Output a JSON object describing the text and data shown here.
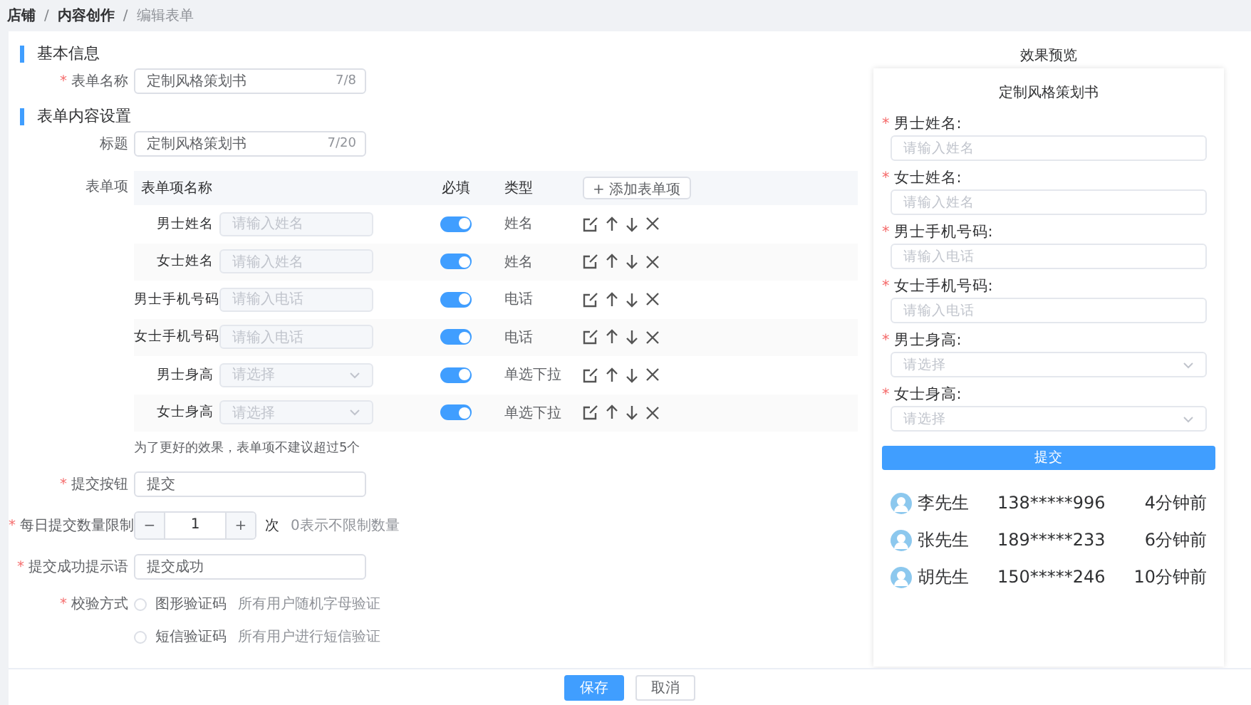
{
  "breadcrumb": [
    {
      "label": "店铺",
      "current": false
    },
    {
      "sep": "/",
      "label": "内容创作",
      "current": false
    },
    {
      "sep": "/",
      "label": "编辑表单",
      "current": true
    }
  ],
  "basic": {
    "heading": "基本信息",
    "name_field": {
      "star": "*",
      "label": "表单名称",
      "value": "定制风格策划书",
      "count": "7/8"
    }
  },
  "content": {
    "heading": "表单内容设置",
    "title_field": {
      "label": "标题",
      "value": "定制风格策划书",
      "count": "7/20"
    },
    "items_label": "表单项",
    "table": {
      "columns": [
        "表单项名称",
        "必填",
        "类型"
      ],
      "add_button": {
        "icon": "+",
        "label": "添加表单项"
      },
      "rows": [
        {
          "label": "男士姓名",
          "kind": "input",
          "placeholder": "请输入姓名",
          "required": true,
          "type": "姓名"
        },
        {
          "label": "女士姓名",
          "kind": "input",
          "placeholder": "请输入姓名",
          "required": true,
          "type": "姓名"
        },
        {
          "label": "男士手机号码",
          "kind": "input",
          "placeholder": "请输入电话",
          "required": true,
          "type": "电话"
        },
        {
          "label": "女士手机号码",
          "kind": "input",
          "placeholder": "请输入电话",
          "required": true,
          "type": "电话"
        },
        {
          "label": "男士身高",
          "kind": "select",
          "placeholder": "请选择",
          "required": true,
          "type": "单选下拉"
        },
        {
          "label": "女士身高",
          "kind": "select",
          "placeholder": "请选择",
          "required": true,
          "type": "单选下拉"
        }
      ]
    },
    "note": "为了更好的效果，表单项不建议超过5个",
    "submit_field": {
      "star": "*",
      "label": "提交按钮",
      "value": "提交"
    },
    "limit_field": {
      "star": "*",
      "label": "每日提交数量限制",
      "minus": "−",
      "value": "1",
      "plus": "+",
      "unit": "次",
      "hint": "0表示不限制数量"
    },
    "success_field": {
      "star": "*",
      "label": "提交成功提示语",
      "value": "提交成功"
    },
    "verify_field": {
      "star": "*",
      "label": "校验方式",
      "options": [
        {
          "label": "图形验证码",
          "hint": "所有用户随机字母验证",
          "selected": false
        },
        {
          "label": "短信验证码",
          "hint": "所有用户进行短信验证",
          "selected": false
        }
      ]
    }
  },
  "preview": {
    "heading": "效果预览",
    "title": "定制风格策划书",
    "fields": [
      {
        "star": "*",
        "label": "男士姓名:",
        "kind": "input",
        "placeholder": "请输入姓名"
      },
      {
        "star": "*",
        "label": "女士姓名:",
        "kind": "input",
        "placeholder": "请输入姓名"
      },
      {
        "star": "*",
        "label": "男士手机号码:",
        "kind": "input",
        "placeholder": "请输入电话"
      },
      {
        "star": "*",
        "label": "女士手机号码:",
        "kind": "input",
        "placeholder": "请输入电话"
      },
      {
        "star": "*",
        "label": "男士身高:",
        "kind": "select",
        "placeholder": "请选择"
      },
      {
        "star": "*",
        "label": "女士身高:",
        "kind": "select",
        "placeholder": "请选择"
      }
    ],
    "submit": "提交",
    "records": [
      {
        "name": "李先生",
        "phone": "138*****996",
        "time": "4分钟前"
      },
      {
        "name": "张先生",
        "phone": "189*****233",
        "time": "6分钟前"
      },
      {
        "name": "胡先生",
        "phone": "150*****246",
        "time": "10分钟前"
      }
    ]
  },
  "footer": {
    "buttons": [
      {
        "label": "保存",
        "kind": "primary"
      },
      {
        "label": "取消",
        "kind": "default"
      }
    ]
  }
}
